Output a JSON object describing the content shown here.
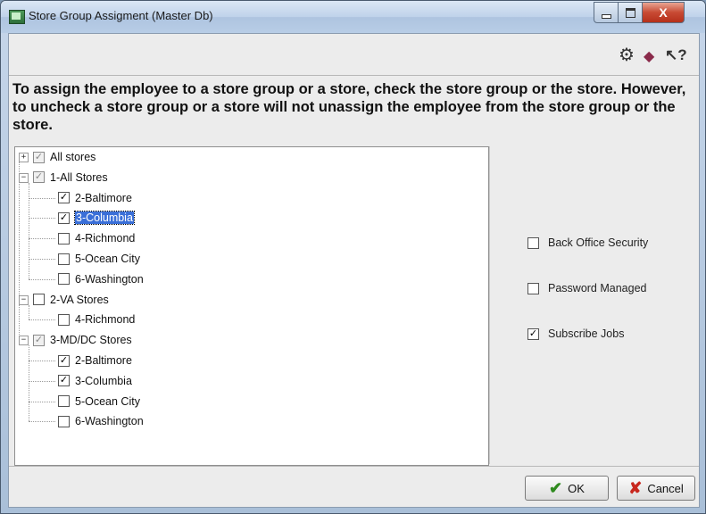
{
  "window": {
    "title": "Store Group Assigment (Master Db)",
    "controls": {
      "close": "X"
    }
  },
  "toolbar": {
    "icons": [
      {
        "name": "settings-puzzle-icon",
        "glyph": "⚙"
      },
      {
        "name": "help-book-icon",
        "glyph": "◆"
      },
      {
        "name": "whats-this-help-icon",
        "glyph": "↖?"
      }
    ]
  },
  "instructions": "To assign the employee to a store group or a store, check the store group or the store. However, to uncheck a store group or a store will not unassign the employee from the store group or the store.",
  "tree": {
    "nodes": [
      {
        "label": "All stores",
        "level": 0,
        "expander": "+",
        "checked": true,
        "grey": true,
        "selected": false
      },
      {
        "label": "1-All Stores",
        "level": 0,
        "expander": "−",
        "checked": true,
        "grey": true,
        "selected": false
      },
      {
        "label": "2-Baltimore",
        "level": 1,
        "expander": "",
        "checked": true,
        "grey": false,
        "selected": false
      },
      {
        "label": "3-Columbia",
        "level": 1,
        "expander": "",
        "checked": true,
        "grey": false,
        "selected": true
      },
      {
        "label": "4-Richmond",
        "level": 1,
        "expander": "",
        "checked": false,
        "grey": false,
        "selected": false
      },
      {
        "label": "5-Ocean City",
        "level": 1,
        "expander": "",
        "checked": false,
        "grey": false,
        "selected": false
      },
      {
        "label": "6-Washington",
        "level": 1,
        "expander": "",
        "checked": false,
        "grey": false,
        "selected": false
      },
      {
        "label": "2-VA Stores",
        "level": 0,
        "expander": "−",
        "checked": false,
        "grey": false,
        "selected": false
      },
      {
        "label": "4-Richmond",
        "level": 1,
        "expander": "",
        "checked": false,
        "grey": false,
        "selected": false
      },
      {
        "label": "3-MD/DC Stores",
        "level": 0,
        "expander": "−",
        "checked": true,
        "grey": true,
        "selected": false
      },
      {
        "label": "2-Baltimore",
        "level": 1,
        "expander": "",
        "checked": true,
        "grey": false,
        "selected": false
      },
      {
        "label": "3-Columbia",
        "level": 1,
        "expander": "",
        "checked": true,
        "grey": false,
        "selected": false
      },
      {
        "label": "5-Ocean City",
        "level": 1,
        "expander": "",
        "checked": false,
        "grey": false,
        "selected": false
      },
      {
        "label": "6-Washington",
        "level": 1,
        "expander": "",
        "checked": false,
        "grey": false,
        "selected": false
      }
    ]
  },
  "options": [
    {
      "label": "Back Office Security",
      "checked": false
    },
    {
      "label": "Password Managed",
      "checked": false
    },
    {
      "label": "Subscribe Jobs",
      "checked": true
    }
  ],
  "buttons": {
    "ok": "OK",
    "cancel": "Cancel"
  },
  "colors": {
    "selection": "#3a6fd8",
    "ok_check": "#2f8a1e",
    "cancel_x": "#c8281e"
  }
}
